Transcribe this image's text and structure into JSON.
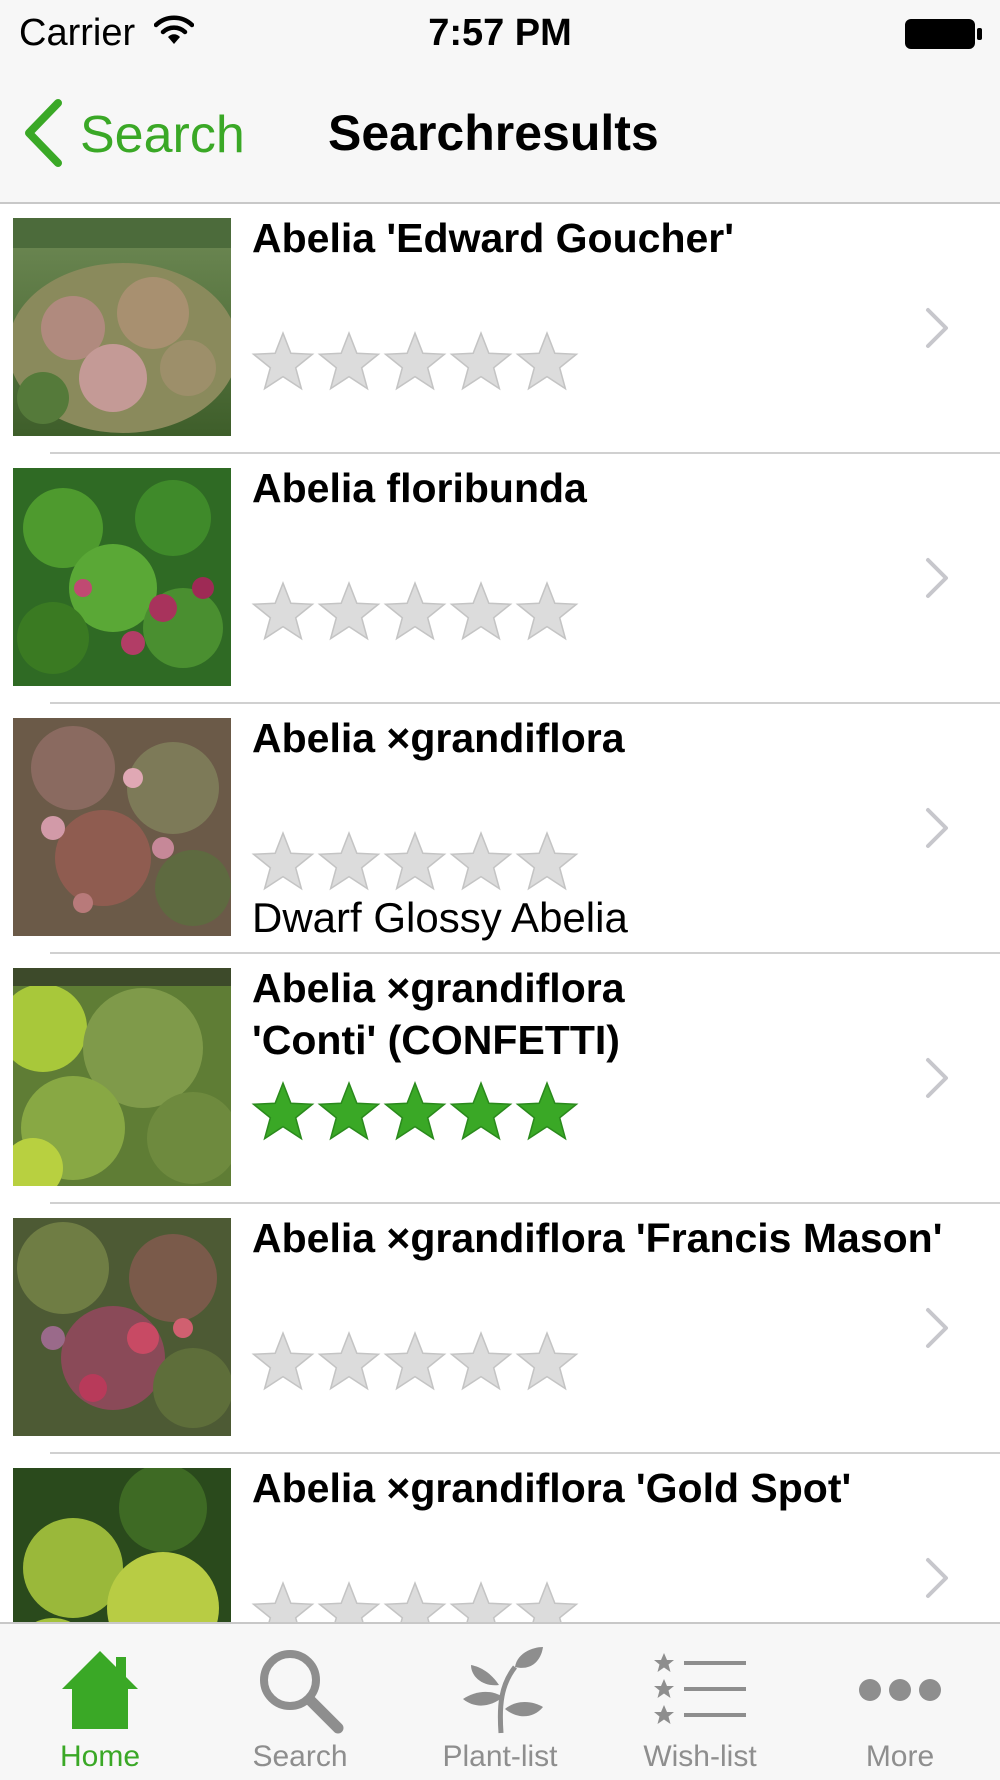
{
  "status_bar": {
    "carrier": "Carrier",
    "time": "7:57 PM"
  },
  "nav": {
    "back_label": "Search",
    "title": "Searchresults"
  },
  "colors": {
    "accent": "#3aa826",
    "inactive": "#8e8e8e",
    "star_filled": "#3aa826",
    "star_empty": "#dcdcdc"
  },
  "results": [
    {
      "name": "Abelia 'Edward Goucher'",
      "common_name": "",
      "rating": 0,
      "max_rating": 5
    },
    {
      "name": "Abelia floribunda",
      "common_name": "",
      "rating": 0,
      "max_rating": 5
    },
    {
      "name": "Abelia ×grandiflora",
      "common_name": "Dwarf Glossy Abelia",
      "rating": 0,
      "max_rating": 5
    },
    {
      "name": "Abelia ×grandiflora 'Conti' (CONFETTI)",
      "common_name": "",
      "rating": 5,
      "max_rating": 5
    },
    {
      "name": "Abelia ×grandiflora 'Francis Mason'",
      "common_name": "",
      "rating": 0,
      "max_rating": 5
    },
    {
      "name": "Abelia ×grandiflora 'Gold Spot'",
      "common_name": "",
      "rating": 0,
      "max_rating": 5
    }
  ],
  "tabs": [
    {
      "label": "Home",
      "icon": "home-icon",
      "active": true
    },
    {
      "label": "Search",
      "icon": "search-icon",
      "active": false
    },
    {
      "label": "Plant-list",
      "icon": "plant-icon",
      "active": false
    },
    {
      "label": "Wish-list",
      "icon": "star-list-icon",
      "active": false
    },
    {
      "label": "More",
      "icon": "more-icon",
      "active": false
    }
  ]
}
